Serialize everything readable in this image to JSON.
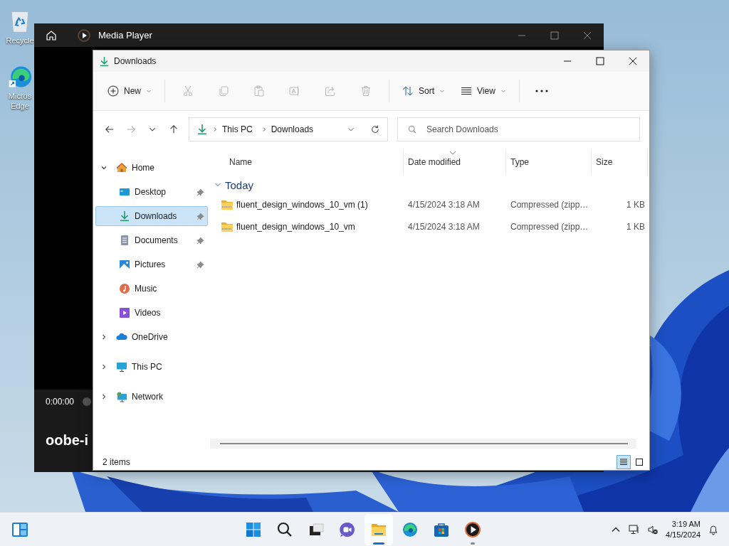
{
  "desktop_icons": [
    {
      "kind": "recycle",
      "lines": [
        "Recycle"
      ]
    },
    {
      "kind": "edge",
      "lines": [
        "Micros",
        "Edge"
      ]
    }
  ],
  "media_player": {
    "title": "Media Player",
    "time": "0:00:00",
    "media_title": "oobe-i"
  },
  "explorer": {
    "title": "Downloads",
    "toolbar": {
      "new_label": "New",
      "actions": [
        {
          "kind": "cut",
          "disabled": true
        },
        {
          "kind": "copy",
          "disabled": true
        },
        {
          "kind": "paste",
          "disabled": true
        },
        {
          "kind": "rename",
          "disabled": true
        },
        {
          "kind": "share",
          "disabled": true
        },
        {
          "kind": "delete",
          "disabled": true
        }
      ],
      "sort_label": "Sort",
      "view_label": "View"
    },
    "nav_buttons": [
      {
        "kind": "back",
        "disabled": false
      },
      {
        "kind": "forward",
        "disabled": true
      },
      {
        "kind": "recent",
        "disabled": false
      },
      {
        "kind": "up",
        "disabled": false
      }
    ],
    "address": {
      "segments": [
        "This PC",
        "Downloads"
      ]
    },
    "search": {
      "placeholder": "Search Downloads"
    },
    "sidebar": [
      {
        "label": "Home",
        "kind": "home",
        "expanded": true,
        "selected": false,
        "children": [
          {
            "label": "Desktop",
            "kind": "desktop",
            "pinned": true,
            "selected": false
          },
          {
            "label": "Downloads",
            "kind": "downloads",
            "pinned": true,
            "selected": true
          },
          {
            "label": "Documents",
            "kind": "documents",
            "pinned": true,
            "selected": false
          },
          {
            "label": "Pictures",
            "kind": "pictures",
            "pinned": true,
            "selected": false
          },
          {
            "label": "Music",
            "kind": "music",
            "pinned": false,
            "selected": false
          },
          {
            "label": "Videos",
            "kind": "videos",
            "pinned": false,
            "selected": false
          }
        ]
      },
      {
        "label": "OneDrive",
        "kind": "onedrive",
        "expanded": false,
        "selected": false
      },
      {
        "label": "This PC",
        "kind": "pc",
        "expanded": false,
        "selected": false
      },
      {
        "label": "Network",
        "kind": "network",
        "expanded": false,
        "selected": false
      }
    ],
    "columns": [
      {
        "label": "Name",
        "sorted": false
      },
      {
        "label": "Date modified",
        "sorted": true
      },
      {
        "label": "Type",
        "sorted": false
      },
      {
        "label": "Size",
        "sorted": false
      }
    ],
    "groups": [
      {
        "label": "Today",
        "expanded": true,
        "rows": [
          {
            "name": "fluent_design_windows_10_vm (1)",
            "date": "4/15/2024 3:18 AM",
            "type": "Compressed (zipp…",
            "size": "1 KB"
          },
          {
            "name": "fluent_design_windows_10_vm",
            "date": "4/15/2024 3:18 AM",
            "type": "Compressed (zipp…",
            "size": "1 KB"
          }
        ]
      }
    ],
    "status": "2 items",
    "view_buttons": [
      {
        "kind": "details",
        "selected": true
      },
      {
        "kind": "tiles",
        "selected": false
      }
    ]
  },
  "taskbar": {
    "apps": [
      {
        "kind": "start",
        "open": false,
        "focused": false
      },
      {
        "kind": "search",
        "open": false,
        "focused": false
      },
      {
        "kind": "taskview",
        "open": false,
        "focused": false
      },
      {
        "kind": "chat",
        "open": false,
        "focused": false
      },
      {
        "kind": "explorer",
        "open": true,
        "focused": true
      },
      {
        "kind": "edge",
        "open": false,
        "focused": false
      },
      {
        "kind": "store",
        "open": false,
        "focused": false
      },
      {
        "kind": "media",
        "open": true,
        "focused": false
      }
    ],
    "time": "3:19 AM",
    "date": "4/15/2024"
  }
}
